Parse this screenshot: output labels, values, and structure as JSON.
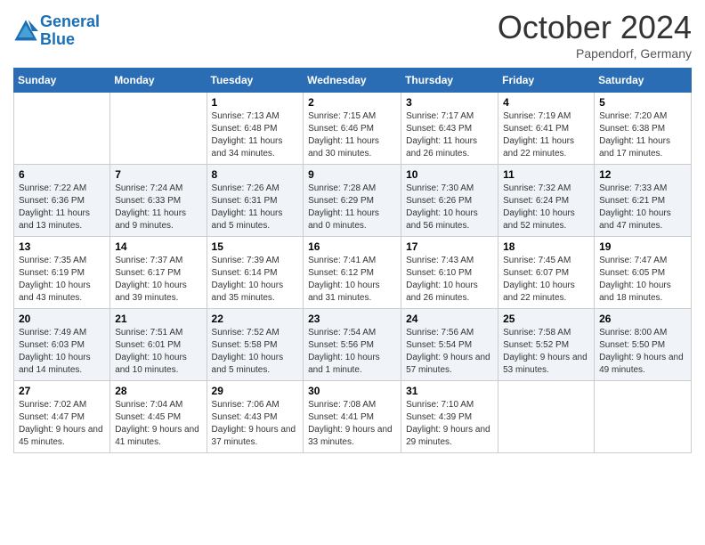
{
  "header": {
    "logo_line1": "General",
    "logo_line2": "Blue",
    "month": "October 2024",
    "location": "Papendorf, Germany"
  },
  "days_of_week": [
    "Sunday",
    "Monday",
    "Tuesday",
    "Wednesday",
    "Thursday",
    "Friday",
    "Saturday"
  ],
  "weeks": [
    [
      {
        "num": "",
        "sunrise": "",
        "sunset": "",
        "daylight": ""
      },
      {
        "num": "",
        "sunrise": "",
        "sunset": "",
        "daylight": ""
      },
      {
        "num": "1",
        "sunrise": "Sunrise: 7:13 AM",
        "sunset": "Sunset: 6:48 PM",
        "daylight": "Daylight: 11 hours and 34 minutes."
      },
      {
        "num": "2",
        "sunrise": "Sunrise: 7:15 AM",
        "sunset": "Sunset: 6:46 PM",
        "daylight": "Daylight: 11 hours and 30 minutes."
      },
      {
        "num": "3",
        "sunrise": "Sunrise: 7:17 AM",
        "sunset": "Sunset: 6:43 PM",
        "daylight": "Daylight: 11 hours and 26 minutes."
      },
      {
        "num": "4",
        "sunrise": "Sunrise: 7:19 AM",
        "sunset": "Sunset: 6:41 PM",
        "daylight": "Daylight: 11 hours and 22 minutes."
      },
      {
        "num": "5",
        "sunrise": "Sunrise: 7:20 AM",
        "sunset": "Sunset: 6:38 PM",
        "daylight": "Daylight: 11 hours and 17 minutes."
      }
    ],
    [
      {
        "num": "6",
        "sunrise": "Sunrise: 7:22 AM",
        "sunset": "Sunset: 6:36 PM",
        "daylight": "Daylight: 11 hours and 13 minutes."
      },
      {
        "num": "7",
        "sunrise": "Sunrise: 7:24 AM",
        "sunset": "Sunset: 6:33 PM",
        "daylight": "Daylight: 11 hours and 9 minutes."
      },
      {
        "num": "8",
        "sunrise": "Sunrise: 7:26 AM",
        "sunset": "Sunset: 6:31 PM",
        "daylight": "Daylight: 11 hours and 5 minutes."
      },
      {
        "num": "9",
        "sunrise": "Sunrise: 7:28 AM",
        "sunset": "Sunset: 6:29 PM",
        "daylight": "Daylight: 11 hours and 0 minutes."
      },
      {
        "num": "10",
        "sunrise": "Sunrise: 7:30 AM",
        "sunset": "Sunset: 6:26 PM",
        "daylight": "Daylight: 10 hours and 56 minutes."
      },
      {
        "num": "11",
        "sunrise": "Sunrise: 7:32 AM",
        "sunset": "Sunset: 6:24 PM",
        "daylight": "Daylight: 10 hours and 52 minutes."
      },
      {
        "num": "12",
        "sunrise": "Sunrise: 7:33 AM",
        "sunset": "Sunset: 6:21 PM",
        "daylight": "Daylight: 10 hours and 47 minutes."
      }
    ],
    [
      {
        "num": "13",
        "sunrise": "Sunrise: 7:35 AM",
        "sunset": "Sunset: 6:19 PM",
        "daylight": "Daylight: 10 hours and 43 minutes."
      },
      {
        "num": "14",
        "sunrise": "Sunrise: 7:37 AM",
        "sunset": "Sunset: 6:17 PM",
        "daylight": "Daylight: 10 hours and 39 minutes."
      },
      {
        "num": "15",
        "sunrise": "Sunrise: 7:39 AM",
        "sunset": "Sunset: 6:14 PM",
        "daylight": "Daylight: 10 hours and 35 minutes."
      },
      {
        "num": "16",
        "sunrise": "Sunrise: 7:41 AM",
        "sunset": "Sunset: 6:12 PM",
        "daylight": "Daylight: 10 hours and 31 minutes."
      },
      {
        "num": "17",
        "sunrise": "Sunrise: 7:43 AM",
        "sunset": "Sunset: 6:10 PM",
        "daylight": "Daylight: 10 hours and 26 minutes."
      },
      {
        "num": "18",
        "sunrise": "Sunrise: 7:45 AM",
        "sunset": "Sunset: 6:07 PM",
        "daylight": "Daylight: 10 hours and 22 minutes."
      },
      {
        "num": "19",
        "sunrise": "Sunrise: 7:47 AM",
        "sunset": "Sunset: 6:05 PM",
        "daylight": "Daylight: 10 hours and 18 minutes."
      }
    ],
    [
      {
        "num": "20",
        "sunrise": "Sunrise: 7:49 AM",
        "sunset": "Sunset: 6:03 PM",
        "daylight": "Daylight: 10 hours and 14 minutes."
      },
      {
        "num": "21",
        "sunrise": "Sunrise: 7:51 AM",
        "sunset": "Sunset: 6:01 PM",
        "daylight": "Daylight: 10 hours and 10 minutes."
      },
      {
        "num": "22",
        "sunrise": "Sunrise: 7:52 AM",
        "sunset": "Sunset: 5:58 PM",
        "daylight": "Daylight: 10 hours and 5 minutes."
      },
      {
        "num": "23",
        "sunrise": "Sunrise: 7:54 AM",
        "sunset": "Sunset: 5:56 PM",
        "daylight": "Daylight: 10 hours and 1 minute."
      },
      {
        "num": "24",
        "sunrise": "Sunrise: 7:56 AM",
        "sunset": "Sunset: 5:54 PM",
        "daylight": "Daylight: 9 hours and 57 minutes."
      },
      {
        "num": "25",
        "sunrise": "Sunrise: 7:58 AM",
        "sunset": "Sunset: 5:52 PM",
        "daylight": "Daylight: 9 hours and 53 minutes."
      },
      {
        "num": "26",
        "sunrise": "Sunrise: 8:00 AM",
        "sunset": "Sunset: 5:50 PM",
        "daylight": "Daylight: 9 hours and 49 minutes."
      }
    ],
    [
      {
        "num": "27",
        "sunrise": "Sunrise: 7:02 AM",
        "sunset": "Sunset: 4:47 PM",
        "daylight": "Daylight: 9 hours and 45 minutes."
      },
      {
        "num": "28",
        "sunrise": "Sunrise: 7:04 AM",
        "sunset": "Sunset: 4:45 PM",
        "daylight": "Daylight: 9 hours and 41 minutes."
      },
      {
        "num": "29",
        "sunrise": "Sunrise: 7:06 AM",
        "sunset": "Sunset: 4:43 PM",
        "daylight": "Daylight: 9 hours and 37 minutes."
      },
      {
        "num": "30",
        "sunrise": "Sunrise: 7:08 AM",
        "sunset": "Sunset: 4:41 PM",
        "daylight": "Daylight: 9 hours and 33 minutes."
      },
      {
        "num": "31",
        "sunrise": "Sunrise: 7:10 AM",
        "sunset": "Sunset: 4:39 PM",
        "daylight": "Daylight: 9 hours and 29 minutes."
      },
      {
        "num": "",
        "sunrise": "",
        "sunset": "",
        "daylight": ""
      },
      {
        "num": "",
        "sunrise": "",
        "sunset": "",
        "daylight": ""
      }
    ]
  ]
}
